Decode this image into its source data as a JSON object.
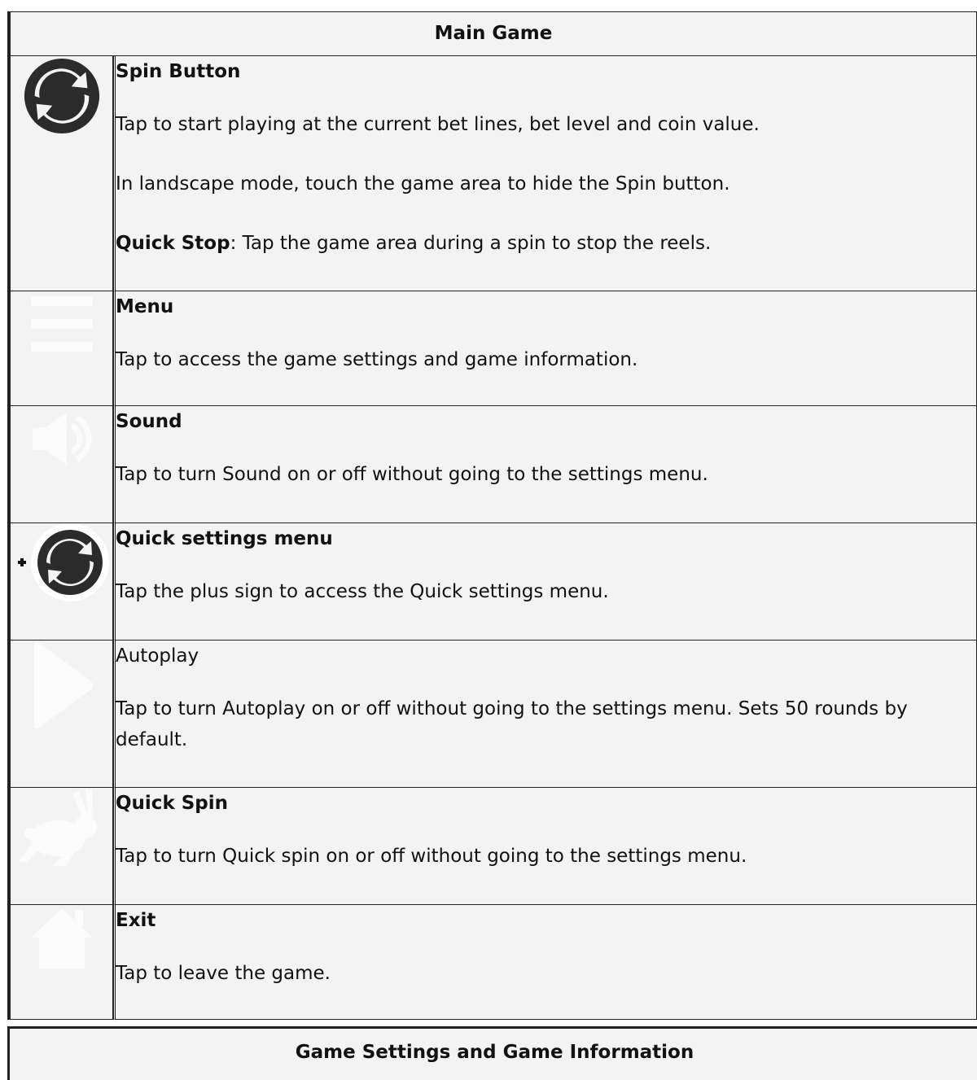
{
  "main_section": {
    "title": "Main Game"
  },
  "items": [
    {
      "icon": "spin-icon",
      "title": "Spin Button",
      "title_bold": true,
      "para1": "Tap to start playing at the current bet lines, bet level and coin value.",
      "para2": "In landscape mode, touch the game area to hide the Spin button.",
      "para3_bold": "Quick Stop",
      "para3_rest": ": Tap the game area during a spin to stop the reels."
    },
    {
      "icon": "menu-icon",
      "title": "Menu",
      "para1": "Tap to access the game settings and game information."
    },
    {
      "icon": "sound-icon",
      "title": "Sound",
      "para1": "Tap to turn Sound on or off without going to the settings menu."
    },
    {
      "icon": "quick-settings-icon",
      "title": "Quick settings menu",
      "para1": "Tap the plus sign to access the Quick settings menu."
    },
    {
      "icon": "autoplay-icon",
      "title": "Autoplay",
      "para1": "Tap to turn Autoplay on or off without going to the settings menu. Sets 50 rounds by default."
    },
    {
      "icon": "rabbit-icon",
      "title": "Quick Spin",
      "para1": "Tap to turn Quick spin on or off without going to the settings menu."
    },
    {
      "icon": "home-icon",
      "title": "Exit",
      "para1": "Tap to leave the game."
    }
  ],
  "next_section": {
    "title": "Game Settings and Game Information"
  }
}
